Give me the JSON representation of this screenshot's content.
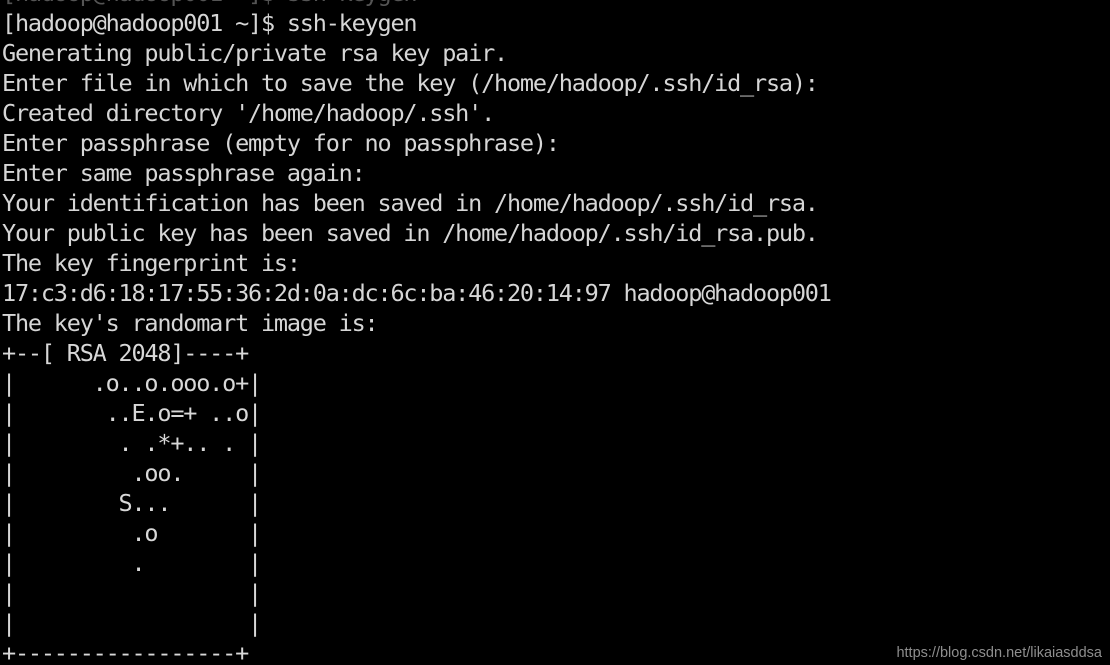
{
  "terminal": {
    "title": "hadoop@hadoop001:~",
    "background_color": "#000000",
    "foreground_color": "#d6d6d6",
    "prompt": "[hadoop@hadoop001 ~]$",
    "command": "ssh-keygen",
    "cols": 68,
    "rows": 23,
    "lines": [
      "[hadoop@hadoop001 ~]$ ssh-keygen",
      "Generating public/private rsa key pair.",
      "Enter file in which to save the key (/home/hadoop/.ssh/id_rsa):",
      "Created directory '/home/hadoop/.ssh'.",
      "Enter passphrase (empty for no passphrase):",
      "Enter same passphrase again:",
      "Your identification has been saved in /home/hadoop/.ssh/id_rsa.",
      "Your public key has been saved in /home/hadoop/.ssh/id_rsa.pub.",
      "The key fingerprint is:",
      "17:c3:d6:18:17:55:36:2d:0a:dc:6c:ba:46:20:14:97 hadoop@hadoop001",
      "The key's randomart image is:",
      "+--[ RSA 2048]----+",
      "|      .o..o.ooo.o+|",
      "|       ..E.o=+ ..o|",
      "|        . .*+.. . |",
      "|         .oo.     |",
      "|        S...      |",
      "|         .o       |",
      "|         .        |",
      "|                  |",
      "|                  |",
      "+-----------------+"
    ],
    "fingerprint": "17:c3:d6:18:17:55:36:2d:0a:dc:6c:ba:46:20:14:97",
    "fingerprint_owner": "hadoop@hadoop001",
    "key_type": "RSA 2048",
    "key_path": "/home/hadoop/.ssh/id_rsa",
    "public_key_path": "/home/hadoop/.ssh/id_rsa.pub",
    "ssh_directory": "/home/hadoop/.ssh"
  },
  "watermark": {
    "text": "https://blog.csdn.net/likaiasddsa"
  }
}
